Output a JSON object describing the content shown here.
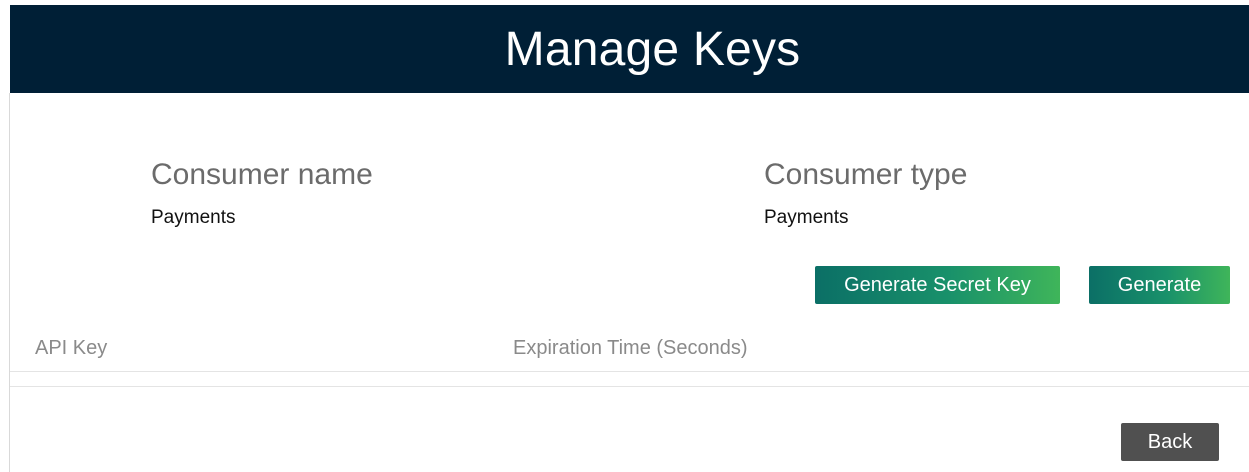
{
  "header": {
    "title": "Manage Keys"
  },
  "consumer": {
    "name_label": "Consumer name",
    "name_value": "Payments",
    "type_label": "Consumer type",
    "type_value": "Payments"
  },
  "actions": {
    "generate_secret_key_label": "Generate Secret Key",
    "generate_label": "Generate"
  },
  "keys_table": {
    "columns": [
      "API Key",
      "Expiration Time (Seconds)"
    ],
    "rows": []
  },
  "footer": {
    "back_label": "Back"
  },
  "colors": {
    "header_bg": "#001f36",
    "primary_button_start": "#0b6f66",
    "primary_button_end": "#3fb55a",
    "back_button": "#505050"
  }
}
